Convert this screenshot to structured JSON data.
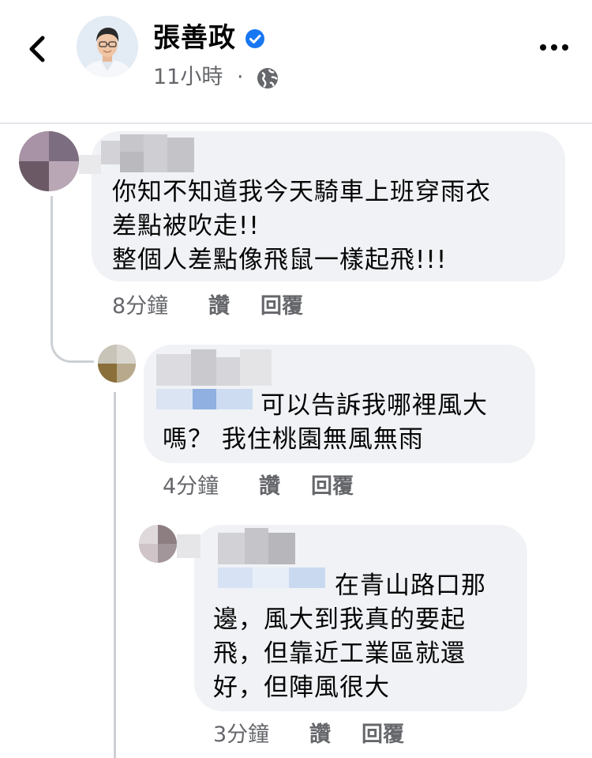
{
  "header": {
    "author_name": "張善政",
    "post_time": "11小時",
    "separator": "·",
    "icons": {
      "back": "chevron-left-icon",
      "verified": "verified-badge-icon",
      "audience": "globe-icon",
      "more": "more-horizontal-icon"
    }
  },
  "comments": [
    {
      "text_lines": [
        "你知不知道我今天騎車上班穿雨衣",
        "差點被吹走!!",
        "整個人差點像飛鼠一樣起飛!!!"
      ],
      "time": "8分鐘",
      "like_label": "讚",
      "reply_label": "回覆"
    },
    {
      "text_lines": [
        "可以告訴我哪裡風大",
        "嗎？ 我住桃園無風無雨"
      ],
      "time": "4分鐘",
      "like_label": "讚",
      "reply_label": "回覆"
    },
    {
      "text_lines": [
        "在青山路口那",
        "邊，風大到我真的要起",
        "飛，但靠近工業區就還",
        "好，但陣風很大"
      ],
      "time": "3分鐘",
      "like_label": "讚",
      "reply_label": "回覆"
    }
  ],
  "colors": {
    "bubble": "#f0f2f5",
    "meta_text": "#65676b",
    "verified": "#1877f2",
    "thread_line": "#ccd0d5"
  }
}
